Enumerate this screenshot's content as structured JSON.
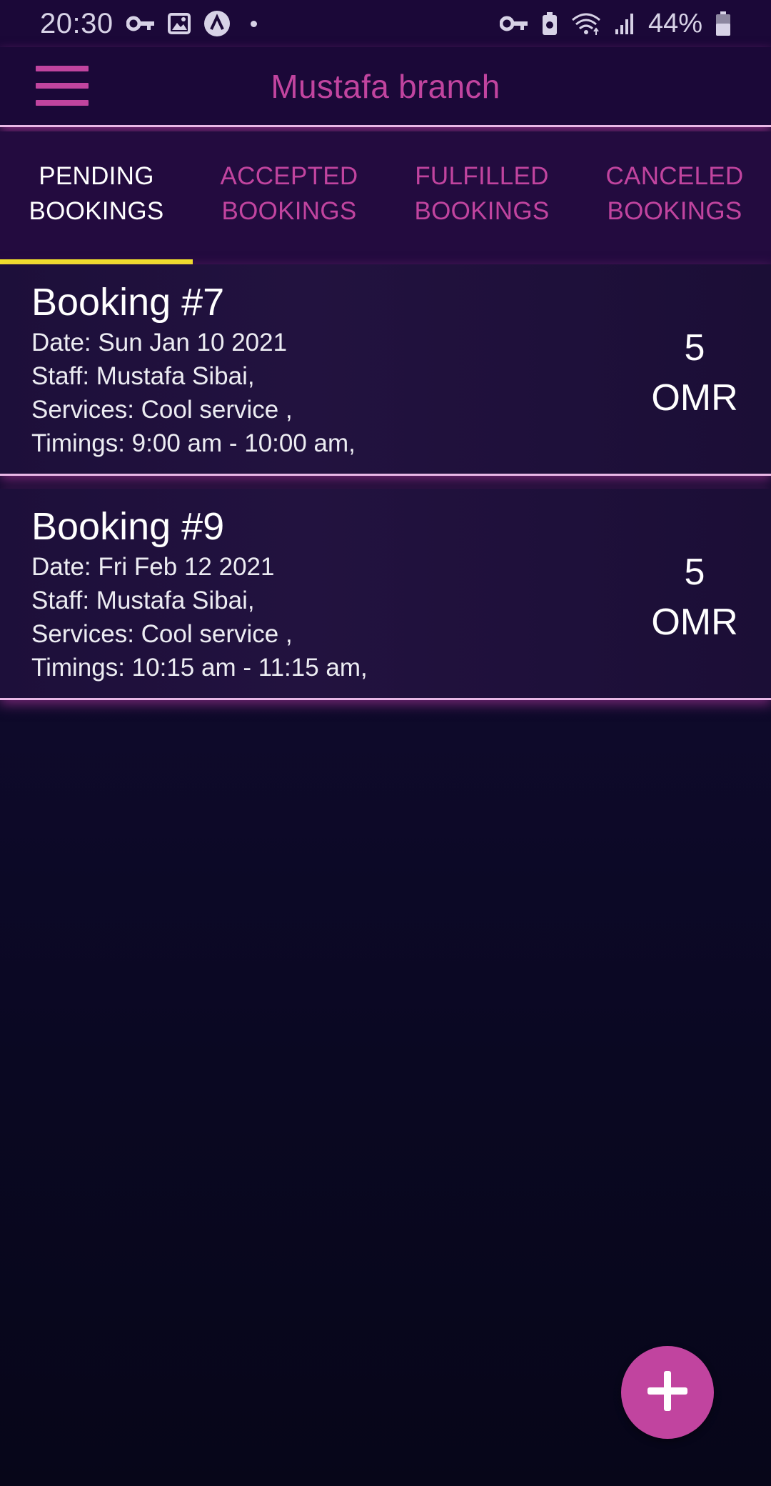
{
  "status_bar": {
    "time": "20:30",
    "battery": "44%",
    "left_icons": [
      "vpn-key-icon",
      "image-icon",
      "app-a-icon",
      "dot-icon"
    ],
    "right_icons": [
      "vpn-key-icon",
      "battery-saver-icon",
      "wifi-icon",
      "signal-icon",
      "battery-icon"
    ]
  },
  "app_bar": {
    "title": "Mustafa branch",
    "menu_icon": "hamburger-menu-icon"
  },
  "tabs": [
    {
      "label": "PENDING\nBOOKINGS",
      "active": true
    },
    {
      "label": "ACCEPTED\nBOOKINGS",
      "active": false
    },
    {
      "label": "FULFILLED\nBOOKINGS",
      "active": false
    },
    {
      "label": "CANCELED\nBOOKINGS",
      "active": false
    }
  ],
  "bookings": [
    {
      "title": "Booking #7",
      "date": "Date: Sun Jan 10 2021",
      "staff": "Staff: Mustafa Sibai,",
      "services": "Services: Cool service ,",
      "timings": "Timings: 9:00 am - 10:00 am,",
      "price_amount": "5",
      "price_currency": "OMR"
    },
    {
      "title": "Booking #9",
      "date": "Date: Fri Feb 12 2021",
      "staff": "Staff: Mustafa Sibai,",
      "services": "Services: Cool service ,",
      "timings": "Timings: 10:15 am - 11:15 am,",
      "price_amount": "5",
      "price_currency": "OMR"
    }
  ],
  "fab": {
    "icon": "plus-icon"
  },
  "colors": {
    "accent": "#c1449f",
    "tab_indicator": "#f2e626",
    "app_bar_bg": "#1b0838",
    "divider": "#e9b8e6"
  }
}
